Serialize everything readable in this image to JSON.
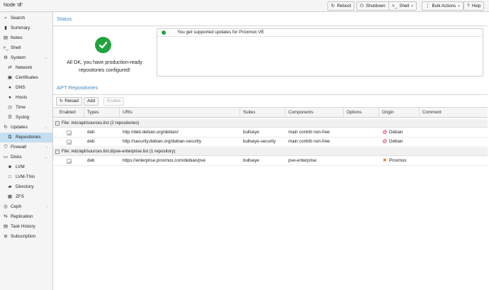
{
  "header": {
    "node_title": "Node 'dl'",
    "buttons": [
      {
        "label": "Reboot",
        "icon": "refresh-icon"
      },
      {
        "label": "Shutdown",
        "icon": "power-icon"
      },
      {
        "label": "Shell",
        "icon": "terminal-icon"
      },
      {
        "label": "Bulk Actions",
        "icon": "ellipsis-icon"
      },
      {
        "label": "Help",
        "icon": "help-icon"
      }
    ]
  },
  "sidebar": {
    "items": [
      {
        "label": "Search",
        "icon": "search-icon"
      },
      {
        "label": "Summary",
        "icon": "book-icon"
      },
      {
        "label": "Notes",
        "icon": "notes-icon"
      },
      {
        "label": "Shell",
        "icon": "terminal-icon",
        "glyph": ">_"
      },
      {
        "label": "System",
        "icon": "gears-icon"
      },
      {
        "label": "Network",
        "icon": "network-icon"
      },
      {
        "label": "Certificates",
        "icon": "certificate-icon"
      },
      {
        "label": "DNS",
        "icon": "globe-icon"
      },
      {
        "label": "Hosts",
        "icon": "globe-icon"
      },
      {
        "label": "Time",
        "icon": "clock-icon"
      },
      {
        "label": "Syslog",
        "icon": "list-icon"
      },
      {
        "label": "Updates",
        "icon": "refresh-icon"
      },
      {
        "label": "Repositories",
        "icon": "repository-icon"
      },
      {
        "label": "Firewall",
        "icon": "shield-icon"
      },
      {
        "label": "Disks",
        "icon": "hdd-icon"
      },
      {
        "label": "LVM",
        "icon": "square-icon"
      },
      {
        "label": "LVM-Thin",
        "icon": "square-outline-icon"
      },
      {
        "label": "Directory",
        "icon": "folder-icon"
      },
      {
        "label": "ZFS",
        "icon": "grid-icon"
      },
      {
        "label": "Ceph",
        "icon": "ceph-icon"
      },
      {
        "label": "Replication",
        "icon": "retweet-icon"
      },
      {
        "label": "Task History",
        "icon": "list-alt-icon"
      },
      {
        "label": "Subscription",
        "icon": "support-icon"
      }
    ]
  },
  "status": {
    "header": "Status",
    "ok_message_line1": "All OK, you have production-ready",
    "ok_message_line2": "repositories configured!",
    "messages": [
      "You get supported updates for Proxmox VE"
    ],
    "ok_color": "#21a33e"
  },
  "apt": {
    "header": "APT Repositories",
    "toolbar": {
      "reload": "Reload",
      "add": "Add",
      "enable": "Enable"
    },
    "columns": [
      "Enabled",
      "Types",
      "URIs",
      "Suites",
      "Components",
      "Options",
      "Origin",
      "Comment"
    ],
    "groups": [
      {
        "label": "File: /etc/apt/sources.list (2 repositories)",
        "rows": [
          {
            "types": "deb",
            "uri": "http://deb.debian.org/debian/",
            "suite": "bullseye",
            "components": "main contrib non-free",
            "origin": "Debian",
            "origin_icon": "debian-swirl-icon"
          },
          {
            "types": "deb",
            "uri": "http://security.debian.org/debian-security",
            "suite": "bullseye-security",
            "components": "main contrib non-free",
            "origin": "Debian",
            "origin_icon": "debian-swirl-icon"
          }
        ]
      },
      {
        "label": "File: /etc/apt/sources.list.d/pve-enterprise.list (1 repository)",
        "rows": [
          {
            "types": "deb",
            "uri": "https://enterprise.proxmox.com/debian/pve",
            "suite": "bullseye",
            "components": "pve-enterprise",
            "origin": "Proxmox",
            "origin_icon": "proxmox-icon"
          }
        ]
      }
    ]
  },
  "colors": {
    "accent": "#3f8bc6",
    "selected": "#c5dff2",
    "debian": "#c70036",
    "proxmox": "#e57000"
  }
}
